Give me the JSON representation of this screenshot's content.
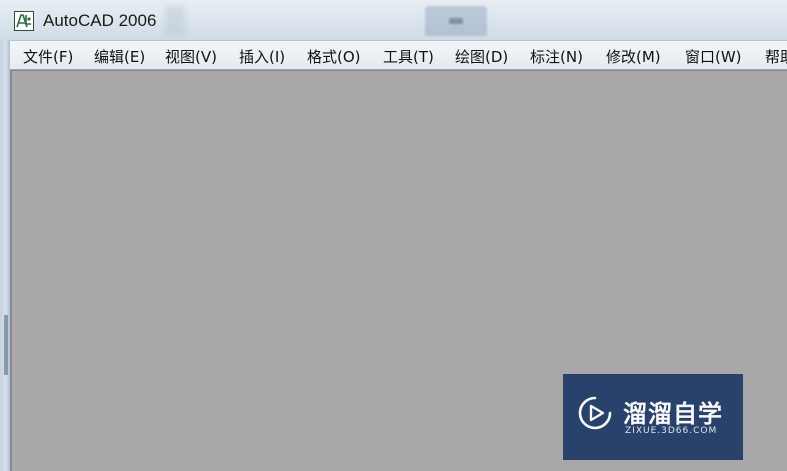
{
  "window": {
    "title": "AutoCAD 2006",
    "app_icon": "autocad-icon"
  },
  "menubar": {
    "items": [
      {
        "label": "文件(F)"
      },
      {
        "label": "编辑(E)"
      },
      {
        "label": "视图(V)"
      },
      {
        "label": "插入(I)"
      },
      {
        "label": "格式(O)"
      },
      {
        "label": "工具(T)"
      },
      {
        "label": "绘图(D)"
      },
      {
        "label": "标注(N)"
      },
      {
        "label": "修改(M)"
      },
      {
        "label": "窗口(W)"
      },
      {
        "label": "帮助"
      }
    ]
  },
  "watermark": {
    "title": "溜溜自学",
    "subtitle": "ZIXUE.3D66.COM",
    "icon": "play-icon",
    "background": "#1f3a66"
  },
  "colors": {
    "client_area": "#a9a7a9",
    "titlebar": "#dfe7ef",
    "menubar": "#eceff4"
  }
}
